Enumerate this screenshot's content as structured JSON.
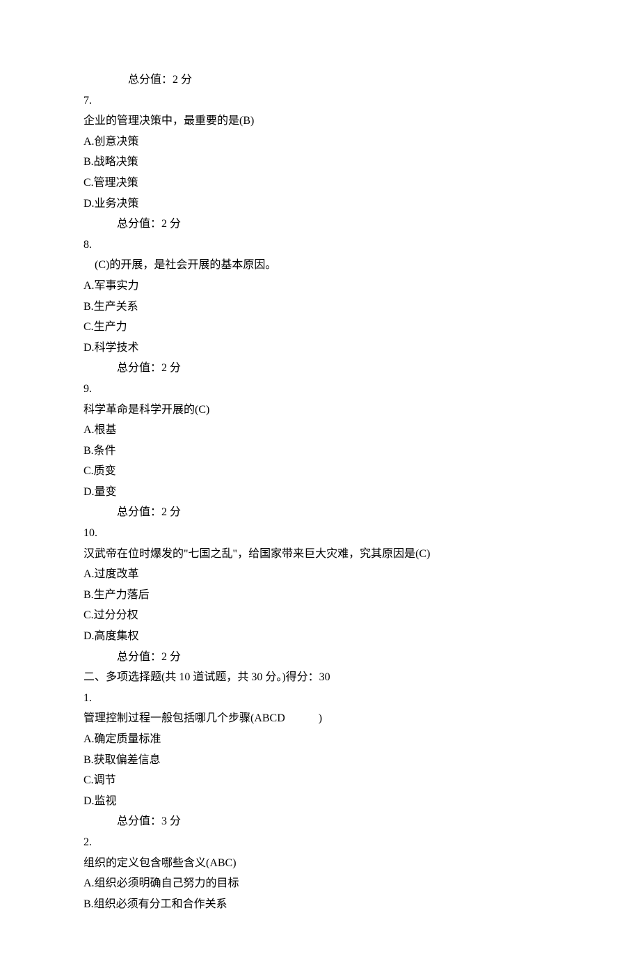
{
  "pre_score": "总分值：2 分",
  "questions": [
    {
      "num": "7.",
      "stem": "企业的管理决策中，最重要的是(B)",
      "options": [
        "A.创意决策",
        "B.战略决策",
        "C.管理决策",
        "D.业务决策"
      ],
      "score": "总分值：2 分"
    },
    {
      "num": "8.",
      "stem": "(C)的开展，是社会开展的基本原因。",
      "stemIndented": true,
      "options": [
        "A.军事实力",
        "B.生产关系",
        "C.生产力",
        "D.科学技术"
      ],
      "score": "总分值：2 分"
    },
    {
      "num": "9.",
      "stem": "科学革命是科学开展的(C)",
      "options": [
        "A.根基",
        "B.条件",
        "C.质变",
        "D.量变"
      ],
      "score": "总分值：2 分"
    },
    {
      "num": "10.",
      "stem": "汉武帝在位时爆发的\"七国之乱\"，给国家带来巨大灾难，究其原因是(C)",
      "options": [
        "A.过度改革",
        "B.生产力落后",
        "C.过分分权",
        "D.高度集权"
      ],
      "score": "总分值：2 分"
    }
  ],
  "section2": {
    "header": "二、多项选择题(共 10 道试题，共 30 分。)得分：30",
    "questions": [
      {
        "num": "1.",
        "stem": "管理控制过程一般包括哪几个步骤(ABCD　　　)",
        "options": [
          "A.确定质量标准",
          "B.获取偏差信息",
          "C.调节",
          "D.监视"
        ],
        "score": "总分值：3 分"
      },
      {
        "num": "2.",
        "stem": "组织的定义包含哪些含义(ABC)",
        "options": [
          "A.组织必须明确自己努力的目标",
          "B.组织必须有分工和合作关系"
        ]
      }
    ]
  }
}
